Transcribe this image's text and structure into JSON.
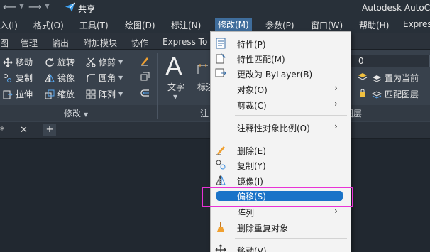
{
  "titlebar": {
    "share_label": "共享",
    "app_title": "Autodesk AutoC"
  },
  "menubar": {
    "items": [
      {
        "label": "入(I)"
      },
      {
        "label": "格式(O)"
      },
      {
        "label": "工具(T)"
      },
      {
        "label": "绘图(D)"
      },
      {
        "label": "标注(N)"
      },
      {
        "label": "修改(M)"
      },
      {
        "label": "参数(P)"
      },
      {
        "label": "窗口(W)"
      },
      {
        "label": "帮助(H)"
      },
      {
        "label": "Expres"
      }
    ]
  },
  "ribbon_tabs": {
    "items": [
      {
        "label": "图"
      },
      {
        "label": "管理"
      },
      {
        "label": "输出"
      },
      {
        "label": "附加模块"
      },
      {
        "label": "协作"
      },
      {
        "label": "Express To"
      }
    ]
  },
  "ribbon": {
    "modify_tools": [
      {
        "label": "移动"
      },
      {
        "label": "旋转"
      },
      {
        "label": "修剪"
      },
      {
        "label": "复制"
      },
      {
        "label": "镜像"
      },
      {
        "label": "圆角"
      },
      {
        "label": "拉伸"
      },
      {
        "label": "缩放"
      },
      {
        "label": "阵列"
      }
    ],
    "modify_panel_title": "修改",
    "text_label": "文字",
    "dim_label": "标注",
    "annotation_panel_title_partial": "注",
    "layer_value": "0",
    "set_current_label": "置为当前",
    "match_layer_label": "匹配图层",
    "layer_panel_title": "图层"
  },
  "context_menu": {
    "items": [
      {
        "label": "特性(P)",
        "icon": "properties-icon",
        "submenu": false
      },
      {
        "label": "特性匹配(M)",
        "icon": "match-properties-icon",
        "submenu": false
      },
      {
        "label": "更改为 ByLayer(B)",
        "icon": "bylayer-icon",
        "submenu": false
      },
      {
        "label": "对象(O)",
        "icon": "",
        "submenu": true
      },
      {
        "label": "剪裁(C)",
        "icon": "",
        "submenu": true
      },
      {
        "label": "注释性对象比例(O)",
        "icon": "",
        "submenu": true
      },
      {
        "label": "删除(E)",
        "icon": "erase-icon",
        "submenu": false
      },
      {
        "label": "复制(Y)",
        "icon": "copy-icon",
        "submenu": false
      },
      {
        "label": "镜像(I)",
        "icon": "mirror-icon",
        "submenu": false
      },
      {
        "label": "偏移(S)",
        "icon": "offset-icon",
        "submenu": false,
        "highlighted": true
      },
      {
        "label": "阵列",
        "icon": "",
        "submenu": true
      },
      {
        "label": "删除重复对象",
        "icon": "overkill-icon",
        "submenu": false
      },
      {
        "label": "移动(V)",
        "icon": "move-icon",
        "submenu": false
      }
    ]
  },
  "colors": {
    "highlight": "#1a73c8",
    "annotation_box": "#e832d6",
    "active_menu": "#3f6d9c"
  }
}
